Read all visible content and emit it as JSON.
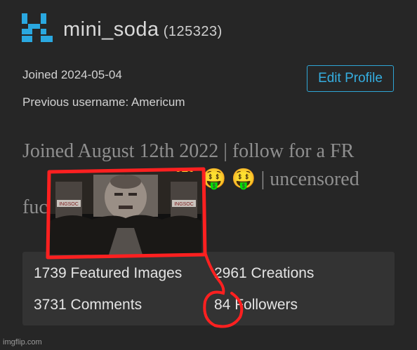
{
  "profile": {
    "logo_icon": "imgflip-logo-icon",
    "username": "mini_soda",
    "points": "(125323)",
    "joined": "Joined 2024-05-04",
    "previous_username": "Previous username: Americum",
    "edit_profile_label": "Edit Profile",
    "bio": "Joined August 12th 2022 | follow for a FR",
    "bio_line2_tail": "| uncensored",
    "bio_line3_head": "fuc",
    "bio_emojis": [
      "money-mouth-face-icon",
      "money-mouth-face-icon",
      "money-mouth-face-icon"
    ]
  },
  "stats": {
    "featured": "1739 Featured Images",
    "creations": "2961 Creations",
    "comments": "3731 Comments",
    "followers": "84 Followers"
  },
  "overlay": {
    "meme_image": "big-brother-screen-image",
    "sign_text": "INGSOC",
    "annotation_color": "#ff2020"
  },
  "watermark": "imgflip.com",
  "colors": {
    "accent": "#35aee0",
    "background": "#262626",
    "stats_panel": "#333333"
  }
}
